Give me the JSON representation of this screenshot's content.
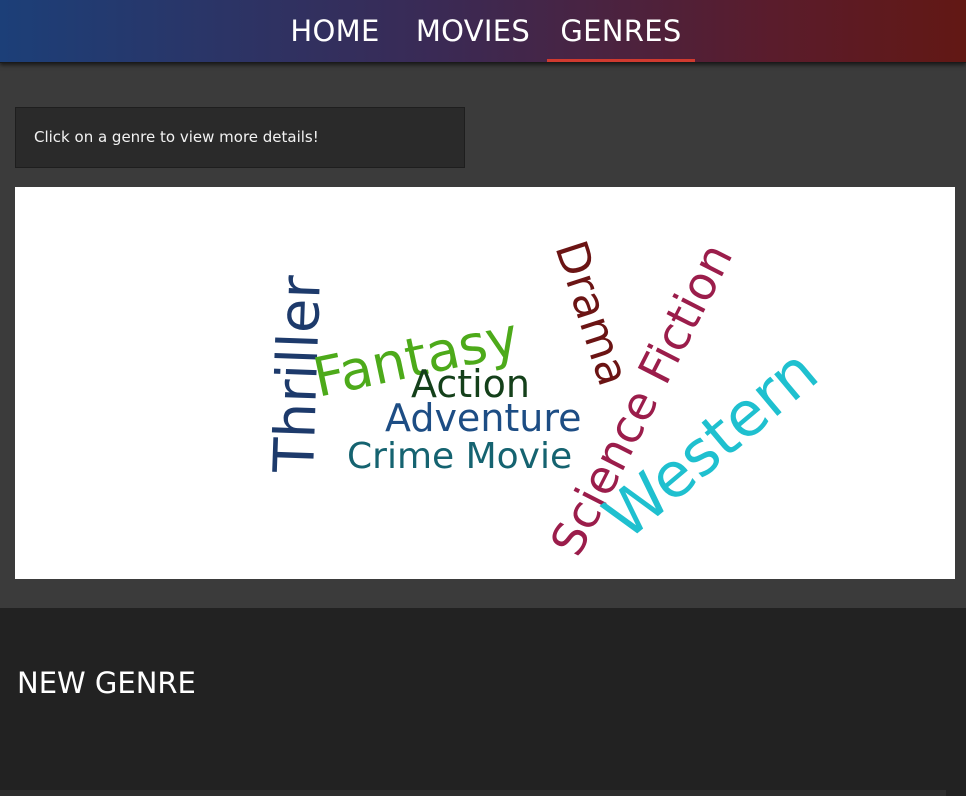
{
  "nav": {
    "items": [
      {
        "label": "HOME",
        "active": false
      },
      {
        "label": "MOVIES",
        "active": false
      },
      {
        "label": "GENRES",
        "active": true
      }
    ],
    "active_underline_color": "#d03a2f"
  },
  "info": {
    "text": "Click on a genre to view more details!"
  },
  "word_cloud": {
    "words": [
      {
        "text": "Thriller",
        "color": "#1d3a6b"
      },
      {
        "text": "Fantasy",
        "color": "#4daa1a"
      },
      {
        "text": "Drama",
        "color": "#6b1414"
      },
      {
        "text": "Science Fiction",
        "color": "#9b1d4b"
      },
      {
        "text": "Western",
        "color": "#1fc0cf"
      },
      {
        "text": "Action",
        "color": "#14401a"
      },
      {
        "text": "Adventure",
        "color": "#1d4d84"
      },
      {
        "text": "Crime Movie",
        "color": "#156370"
      }
    ]
  },
  "new_genre": {
    "title": "NEW GENRE"
  }
}
